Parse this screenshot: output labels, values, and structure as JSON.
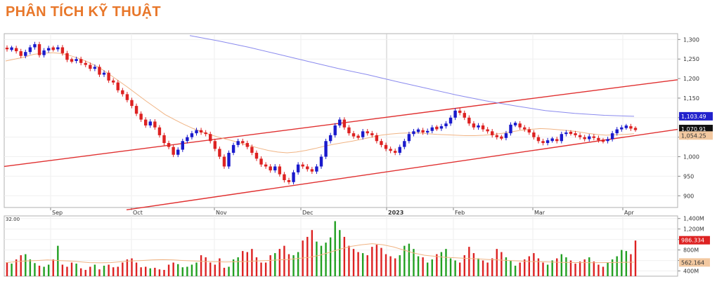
{
  "header": {
    "title": "PHÂN TÍCH KỸ THUẬT",
    "title_color": "#e8772a"
  },
  "colors": {
    "up": "#1a1acc",
    "down": "#dd2222",
    "ma_short": "#f0b484",
    "ma_long": "#8a8aee",
    "channel": "#e03030",
    "vol_up": "#22a022",
    "vol_down": "#dd2222",
    "vol_ma": "#f0b484"
  },
  "chart_data": [
    {
      "type": "candlestick",
      "title": "",
      "x_labels": [
        "Sep",
        "Oct",
        "Nov",
        "Dec",
        "2023",
        "Feb",
        "Mar",
        "Apr"
      ],
      "y_ticks": [
        "1,300",
        "1,250",
        "1,200",
        "1,150",
        "1,100",
        "1,050",
        "1,000",
        "950",
        "900"
      ],
      "ylim": [
        870,
        1315
      ],
      "grid": true,
      "price_tags": [
        {
          "label": "1,103.49",
          "value": 1103.49,
          "color": "#2222cc"
        },
        {
          "label": "1,070.91",
          "value": 1070.91,
          "color": "#111111"
        },
        {
          "label": "1,054.25",
          "value": 1054.25,
          "color": "#f2c8a0"
        }
      ],
      "candles_close": [
        1275,
        1278,
        1270,
        1258,
        1268,
        1280,
        1288,
        1260,
        1272,
        1278,
        1275,
        1280,
        1265,
        1248,
        1245,
        1250,
        1240,
        1235,
        1225,
        1230,
        1210,
        1215,
        1195,
        1190,
        1170,
        1160,
        1145,
        1130,
        1110,
        1095,
        1080,
        1090,
        1075,
        1055,
        1035,
        1025,
        1005,
        1018,
        1040,
        1050,
        1060,
        1068,
        1062,
        1058,
        1040,
        1020,
        1000,
        975,
        1010,
        1030,
        1040,
        1035,
        1025,
        1010,
        995,
        980,
        975,
        965,
        975,
        955,
        940,
        935,
        960,
        980,
        975,
        968,
        962,
        975,
        1000,
        1040,
        1055,
        1080,
        1095,
        1075,
        1060,
        1052,
        1050,
        1065,
        1060,
        1055,
        1040,
        1030,
        1020,
        1015,
        1010,
        1025,
        1040,
        1058,
        1065,
        1068,
        1062,
        1066,
        1075,
        1072,
        1078,
        1085,
        1100,
        1118,
        1112,
        1100,
        1085,
        1075,
        1080,
        1070,
        1065,
        1055,
        1050,
        1048,
        1060,
        1082,
        1085,
        1075,
        1070,
        1062,
        1050,
        1040,
        1035,
        1042,
        1045,
        1040,
        1058,
        1062,
        1060,
        1055,
        1050,
        1045,
        1052,
        1048,
        1042,
        1040,
        1045,
        1060,
        1070,
        1075,
        1078,
        1072,
        1070
      ],
      "candles_dir": [
        "d",
        "u",
        "d",
        "d",
        "u",
        "u",
        "u",
        "d",
        "u",
        "u",
        "d",
        "u",
        "d",
        "d",
        "d",
        "u",
        "d",
        "d",
        "d",
        "u",
        "d",
        "u",
        "d",
        "d",
        "d",
        "d",
        "d",
        "d",
        "d",
        "d",
        "d",
        "u",
        "d",
        "d",
        "d",
        "d",
        "d",
        "u",
        "u",
        "u",
        "u",
        "u",
        "d",
        "d",
        "d",
        "d",
        "d",
        "d",
        "u",
        "u",
        "u",
        "d",
        "d",
        "d",
        "d",
        "d",
        "d",
        "d",
        "u",
        "d",
        "d",
        "d",
        "u",
        "u",
        "d",
        "d",
        "d",
        "u",
        "u",
        "u",
        "u",
        "u",
        "u",
        "d",
        "d",
        "d",
        "d",
        "u",
        "d",
        "d",
        "d",
        "d",
        "d",
        "d",
        "d",
        "u",
        "u",
        "u",
        "u",
        "u",
        "d",
        "u",
        "u",
        "d",
        "u",
        "u",
        "u",
        "u",
        "d",
        "d",
        "d",
        "d",
        "u",
        "d",
        "d",
        "d",
        "d",
        "d",
        "u",
        "u",
        "u",
        "d",
        "d",
        "d",
        "d",
        "d",
        "d",
        "u",
        "u",
        "d",
        "u",
        "u",
        "d",
        "d",
        "d",
        "d",
        "u",
        "d",
        "d",
        "d",
        "u",
        "u",
        "u",
        "u",
        "u",
        "d",
        "d"
      ],
      "ma_short": [
        1245,
        1250,
        1255,
        1262,
        1265,
        1266,
        1264,
        1258,
        1250,
        1240,
        1228,
        1212,
        1195,
        1178,
        1160,
        1142,
        1125,
        1108,
        1095,
        1083,
        1072,
        1063,
        1055,
        1048,
        1042,
        1035,
        1028,
        1022,
        1016,
        1012,
        1010,
        1012,
        1016,
        1021,
        1027,
        1032,
        1036,
        1040,
        1045,
        1050,
        1055,
        1058,
        1060,
        1061,
        1061,
        1059,
        1057,
        1056,
        1055,
        1054,
        1054,
        1055,
        1057,
        1060,
        1064,
        1068,
        1070,
        1072,
        1071,
        1069,
        1067,
        1064,
        1060,
        1057,
        1055,
        1056,
        1057,
        1059
      ],
      "ma_long": [
        1310,
        1296,
        1280,
        1262,
        1244,
        1226,
        1210,
        1192,
        1175,
        1158,
        1143,
        1130,
        1118,
        1111,
        1106,
        1103.5
      ],
      "channel_upper": [
        975,
        1197
      ],
      "channel_lower": [
        864,
        1070
      ]
    },
    {
      "type": "bar",
      "title": "",
      "y_ticks": [
        "1,400M",
        "1,200M",
        "1,000M",
        "800M",
        "600M",
        "400M"
      ],
      "ylim": [
        300,
        1450
      ],
      "left_label": "32.00",
      "volume_tags": [
        {
          "label": "986.334",
          "value": 986,
          "color": "#dd2222"
        },
        {
          "label": "562.164",
          "value": 562,
          "color": "#f2c8a0"
        }
      ],
      "values": [
        560,
        540,
        620,
        700,
        720,
        620,
        550,
        500,
        480,
        520,
        620,
        880,
        520,
        480,
        560,
        540,
        450,
        420,
        480,
        520,
        430,
        500,
        520,
        470,
        480,
        560,
        620,
        640,
        560,
        470,
        480,
        450,
        460,
        430,
        420,
        520,
        560,
        530,
        470,
        480,
        520,
        560,
        700,
        660,
        560,
        520,
        640,
        460,
        480,
        620,
        660,
        780,
        760,
        820,
        660,
        560,
        560,
        700,
        740,
        820,
        880,
        720,
        700,
        760,
        980,
        1050,
        1180,
        960,
        880,
        940,
        1040,
        1350,
        1180,
        1050,
        880,
        820,
        760,
        740,
        700,
        860,
        900,
        840,
        720,
        680,
        640,
        700,
        880,
        920,
        820,
        680,
        660,
        560,
        620,
        720,
        760,
        820,
        640,
        600,
        560,
        700,
        860,
        740,
        640,
        600,
        560,
        640,
        820,
        760,
        660,
        600,
        500,
        560,
        620,
        680,
        740,
        640,
        560,
        520,
        600,
        640,
        720,
        660,
        600,
        540,
        580,
        620,
        660,
        580,
        520,
        480,
        560,
        620,
        680,
        800,
        780,
        720,
        980
      ],
      "colors": [
        "d",
        "u",
        "d",
        "d",
        "u",
        "u",
        "u",
        "d",
        "u",
        "u",
        "d",
        "u",
        "d",
        "d",
        "d",
        "u",
        "d",
        "d",
        "d",
        "u",
        "d",
        "u",
        "d",
        "d",
        "d",
        "d",
        "d",
        "d",
        "d",
        "d",
        "d",
        "u",
        "d",
        "d",
        "d",
        "d",
        "d",
        "u",
        "u",
        "u",
        "u",
        "u",
        "d",
        "d",
        "d",
        "d",
        "d",
        "d",
        "u",
        "u",
        "u",
        "d",
        "d",
        "d",
        "d",
        "d",
        "d",
        "d",
        "u",
        "d",
        "d",
        "d",
        "u",
        "u",
        "d",
        "d",
        "d",
        "u",
        "u",
        "u",
        "u",
        "u",
        "u",
        "d",
        "d",
        "d",
        "d",
        "u",
        "d",
        "d",
        "d",
        "d",
        "d",
        "d",
        "d",
        "u",
        "u",
        "u",
        "u",
        "u",
        "d",
        "u",
        "u",
        "d",
        "u",
        "u",
        "u",
        "u",
        "d",
        "d",
        "d",
        "d",
        "u",
        "d",
        "d",
        "d",
        "d",
        "d",
        "u",
        "u",
        "u",
        "d",
        "d",
        "d",
        "d",
        "d",
        "d",
        "u",
        "u",
        "d",
        "u",
        "u",
        "d",
        "d",
        "d",
        "d",
        "u",
        "d",
        "d",
        "d",
        "u",
        "u",
        "u",
        "u",
        "u",
        "d",
        "d"
      ],
      "ma": [
        560,
        575,
        590,
        600,
        610,
        600,
        590,
        575,
        560,
        555,
        560,
        575,
        590,
        600,
        610,
        615,
        610,
        600,
        590,
        580,
        575,
        570,
        575,
        580,
        590,
        600,
        610,
        620,
        640,
        660,
        700,
        760,
        820,
        870,
        900,
        920,
        900,
        860,
        800,
        740,
        700,
        680,
        660,
        650,
        640,
        630,
        620,
        610,
        600,
        590,
        580,
        575,
        570,
        565,
        562,
        560,
        558,
        560,
        562,
        565,
        567
      ]
    }
  ]
}
